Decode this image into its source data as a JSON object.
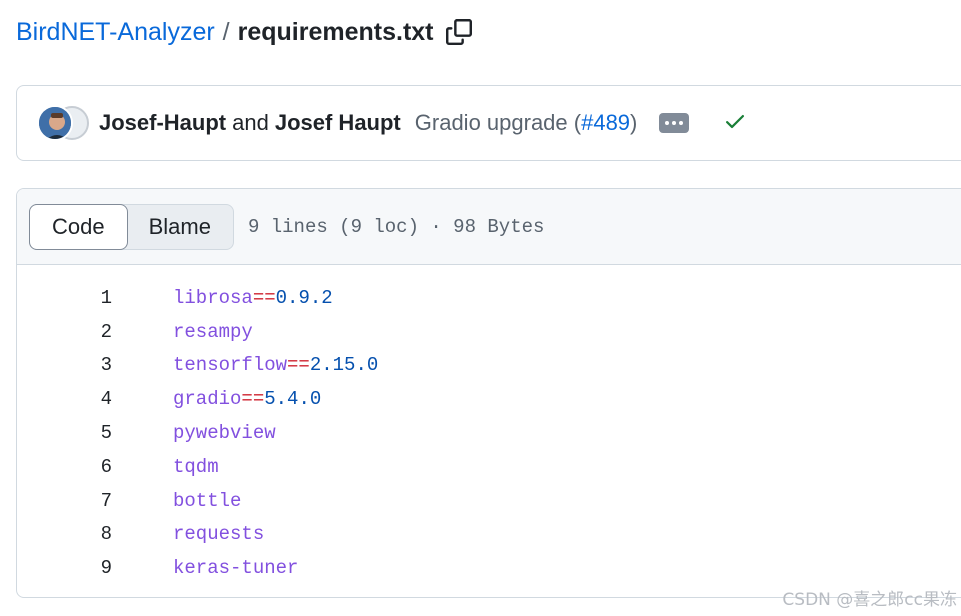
{
  "breadcrumb": {
    "repo": "BirdNET-Analyzer",
    "separator": "/",
    "file": "requirements.txt"
  },
  "commit": {
    "author1": "Josef-Haupt",
    "and": "and",
    "author2": "Josef Haupt",
    "message": "Gradio upgrade (",
    "pr": "#489",
    "message_end": ")",
    "status_color": "#1a7f37"
  },
  "file": {
    "tabs": [
      "Code",
      "Blame"
    ],
    "active_tab": "Code",
    "meta": "9 lines (9 loc) · 98 Bytes"
  },
  "lines": [
    {
      "n": "1",
      "pkg": "librosa",
      "op": "==",
      "ver": "0.9.2"
    },
    {
      "n": "2",
      "pkg": "resampy",
      "op": "",
      "ver": ""
    },
    {
      "n": "3",
      "pkg": "tensorflow",
      "op": "==",
      "ver": "2.15.0"
    },
    {
      "n": "4",
      "pkg": "gradio",
      "op": "==",
      "ver": "5.4.0"
    },
    {
      "n": "5",
      "pkg": "pywebview",
      "op": "",
      "ver": ""
    },
    {
      "n": "6",
      "pkg": "tqdm",
      "op": "",
      "ver": ""
    },
    {
      "n": "7",
      "pkg": "bottle",
      "op": "",
      "ver": ""
    },
    {
      "n": "8",
      "pkg": "requests",
      "op": "",
      "ver": ""
    },
    {
      "n": "9",
      "pkg": "keras-tuner",
      "op": "",
      "ver": ""
    }
  ],
  "watermark": "CSDN @喜之郎cc果冻"
}
